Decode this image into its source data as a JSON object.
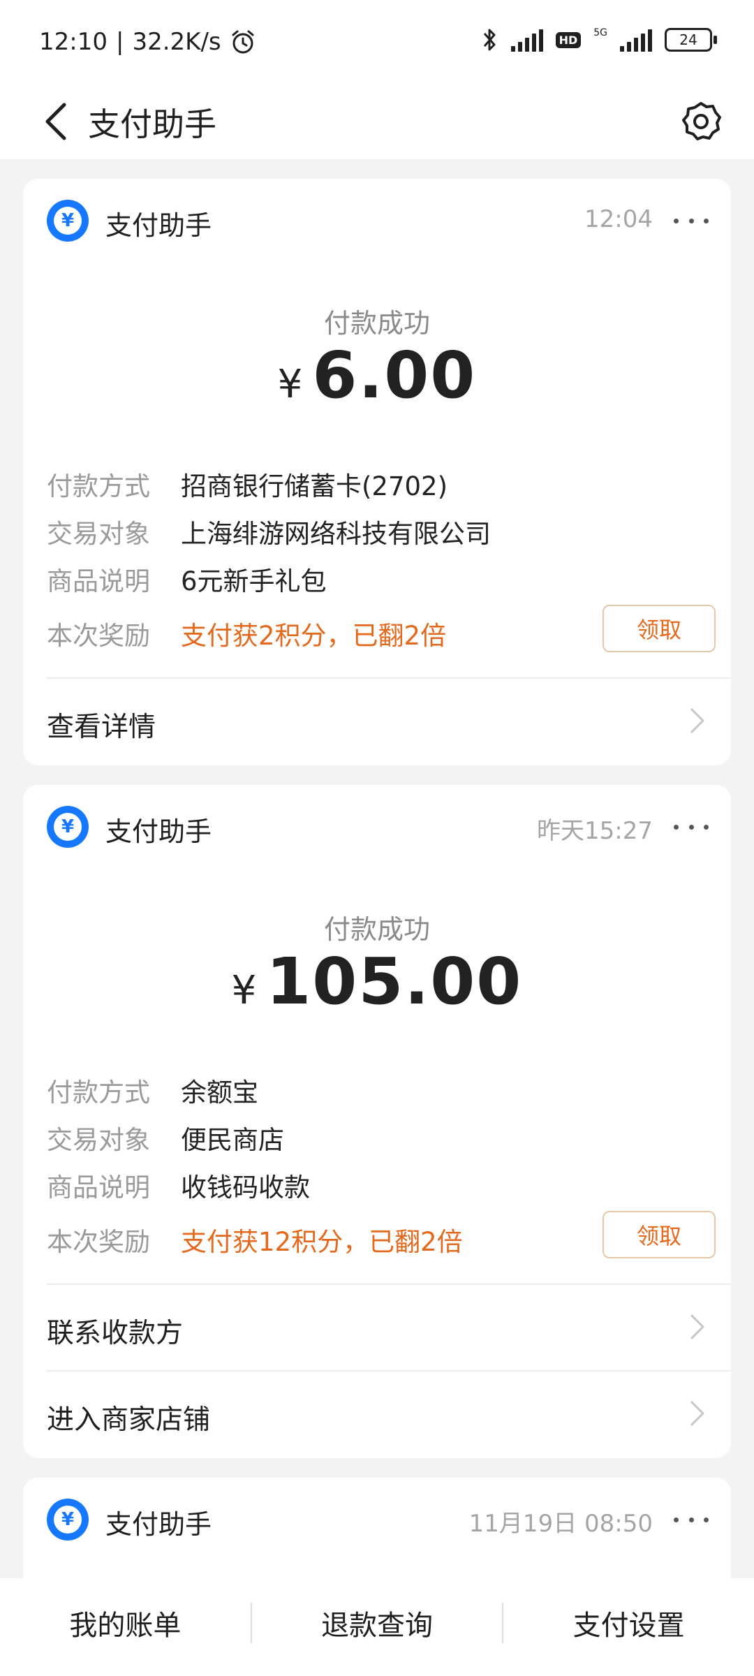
{
  "status_bar": {
    "time": "12:10",
    "separator": "|",
    "speed": "32.2K/s",
    "hd": "HD",
    "net": "5G",
    "battery": "24"
  },
  "header": {
    "title": "支付助手"
  },
  "cards": [
    {
      "app_name": "支付助手",
      "time": "12:04",
      "status": "付款成功",
      "currency": "¥",
      "amount": "6.00",
      "rows": [
        {
          "label": "付款方式",
          "value": "招商银行储蓄卡(2702)"
        },
        {
          "label": "交易对象",
          "value": "上海绯游网络科技有限公司"
        },
        {
          "label": "商品说明",
          "value": "6元新手礼包"
        },
        {
          "label": "本次奖励",
          "value": "支付获2积分，已翻2倍"
        }
      ],
      "claim_label": "领取",
      "links": [
        "查看详情"
      ]
    },
    {
      "app_name": "支付助手",
      "time": "昨天15:27",
      "status": "付款成功",
      "currency": "¥",
      "amount": "105.00",
      "rows": [
        {
          "label": "付款方式",
          "value": "余额宝"
        },
        {
          "label": "交易对象",
          "value": "便民商店"
        },
        {
          "label": "商品说明",
          "value": "收钱码收款"
        },
        {
          "label": "本次奖励",
          "value": "支付获12积分，已翻2倍"
        }
      ],
      "claim_label": "领取",
      "links": [
        "联系收款方",
        "进入商家店铺"
      ]
    },
    {
      "app_name": "支付助手",
      "time": "11月19日 08:50"
    }
  ],
  "bottom_bar": {
    "items": [
      "我的账单",
      "退款查询",
      "支付设置"
    ]
  },
  "colors": {
    "accent_blue": "#1677ff",
    "reward_orange": "#e5691c",
    "background": "#f3f3f3"
  }
}
